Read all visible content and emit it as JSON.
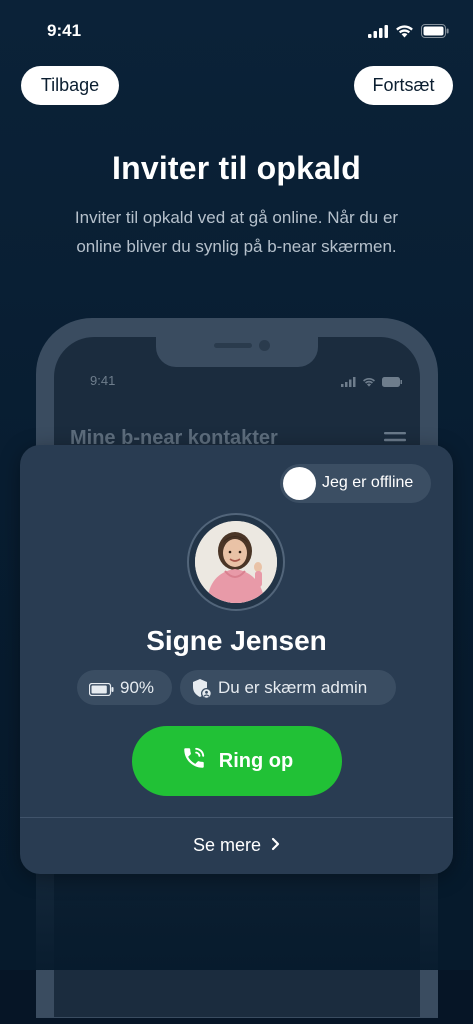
{
  "status_bar": {
    "time": "9:41"
  },
  "nav": {
    "back_label": "Tilbage",
    "next_label": "Fortsæt"
  },
  "header": {
    "title": "Inviter til opkald",
    "subtitle": "Inviter til opkald ved at gå online. Når du er online bliver du synlig på b-near skærmen."
  },
  "mock_phone": {
    "time": "9:41",
    "heading": "Mine b-near kontakter"
  },
  "card": {
    "status_toggle_label": "Jeg er offline",
    "status_online": false,
    "name": "Signe Jensen",
    "battery_label": "90%",
    "battery_level": 0.9,
    "role_label": "Du er skærm admin",
    "call_label": "Ring op",
    "see_more_label": "Se mere"
  },
  "colors": {
    "background": "#0b2238",
    "card": "#293c52",
    "call_button": "#21c136",
    "chip": "#3a4d62"
  },
  "icons": [
    "cellular-icon",
    "wifi-icon",
    "battery-icon",
    "menu-icon",
    "shield-user-icon",
    "phone-call-icon",
    "chevron-right-icon"
  ]
}
